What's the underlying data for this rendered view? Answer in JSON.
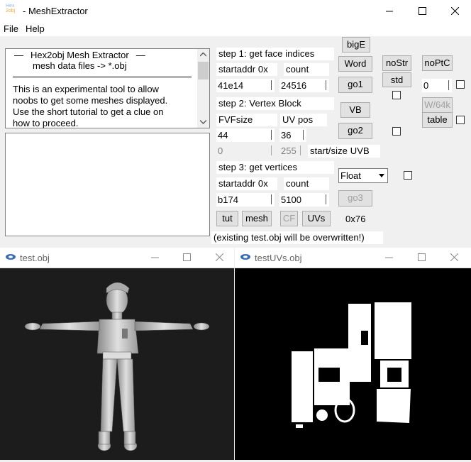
{
  "window": {
    "title": "MeshExtractor",
    "logo_line1": "Hex",
    "logo_line2": "2obj"
  },
  "menu": [
    "File",
    "Help"
  ],
  "info": {
    "heading1": "Hex2obj Mesh Extractor",
    "heading2": "mesh data files -> *.obj",
    "body": [
      "This is an experimental tool to allow",
      "noobs to get some meshes displayed.",
      "Use the short tutorial to get a clue on",
      "how to proceed."
    ]
  },
  "step1": {
    "label": "step 1: get face indices",
    "startaddr_label": "startaddr 0x",
    "count_label": "count",
    "startaddr": "41e14",
    "count": "24516"
  },
  "step2": {
    "label": "step 2: Vertex Block",
    "fvf_label": "FVFsize",
    "uvpos_label": "UV pos",
    "fvf": "44",
    "uvpos": "36",
    "uvb_start": "0",
    "uvb_size": "255",
    "uvb_label": "start/size UVB"
  },
  "step3": {
    "label": "step 3: get vertices",
    "startaddr_label": "startaddr 0x",
    "count_label": "count",
    "startaddr": "b174",
    "count": "5100"
  },
  "buttons": {
    "bigE": "bigE",
    "word": "Word",
    "go1": "go1",
    "vb": "VB",
    "go2": "go2",
    "go3": "go3",
    "nostr": "noStr",
    "std": "std",
    "noptc": "noPtC",
    "w64k": "W/64k",
    "table": "table",
    "tut": "tut",
    "mesh": "mesh",
    "cf": "CF",
    "uvs": "UVs"
  },
  "float_select": "Float",
  "ptc_value": "0",
  "hex_readout": "0x76",
  "warning": "(existing test.obj will be overwritten!)",
  "child1": {
    "title": "test.obj"
  },
  "child2": {
    "title": "testUVs.obj"
  }
}
